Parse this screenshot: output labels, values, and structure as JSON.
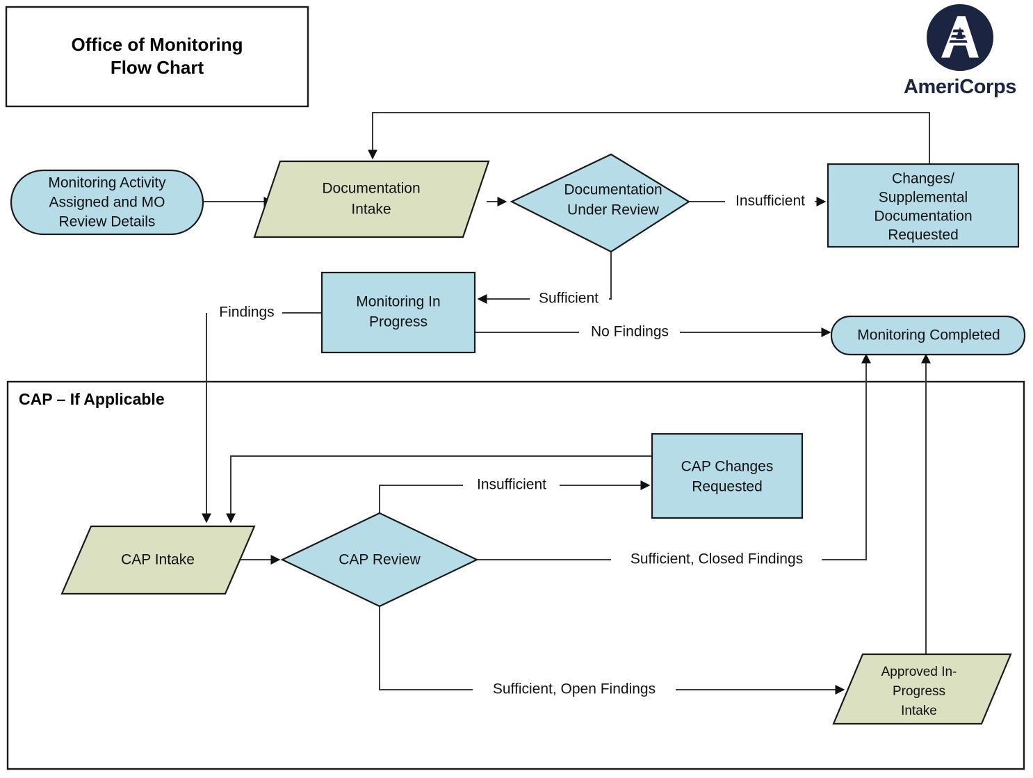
{
  "title": {
    "line1": "Office of Monitoring",
    "line2": "Flow Chart"
  },
  "logo": {
    "name": "americorps-logo",
    "wordmark": "AmeriCorps",
    "color": "#1b2440"
  },
  "colors": {
    "process_blue": "#b5dce7",
    "data_green": "#dae0c0",
    "line": "#3a3a3a",
    "border": "#1a1a1a"
  },
  "nodes": {
    "start": {
      "label": "Monitoring Activity Assigned and MO Review Details",
      "lines": [
        "Monitoring Activity",
        "Assigned and MO",
        "Review Details"
      ],
      "shape": "rounded",
      "fill": "#b5dce7"
    },
    "doc_intake": {
      "label": "Documentation Intake",
      "lines": [
        "Documentation",
        "Intake"
      ],
      "shape": "parallelogram",
      "fill": "#dae0c0"
    },
    "doc_review": {
      "label": "Documentation Under Review",
      "lines": [
        "Documentation",
        "Under Review"
      ],
      "shape": "diamond",
      "fill": "#b5dce7"
    },
    "changes_requested": {
      "label": "Changes/ Supplemental Documentation Requested",
      "lines": [
        "Changes/",
        "Supplemental",
        "Documentation",
        "Requested"
      ],
      "shape": "rectangle",
      "fill": "#b5dce7"
    },
    "monitoring_in_progress": {
      "label": "Monitoring In Progress",
      "lines": [
        "Monitoring In",
        "Progress"
      ],
      "shape": "rectangle",
      "fill": "#b5dce7"
    },
    "monitoring_completed": {
      "label": "Monitoring Completed",
      "lines": [
        "Monitoring Completed"
      ],
      "shape": "rounded",
      "fill": "#b5dce7"
    },
    "cap_intake": {
      "label": "CAP Intake",
      "lines": [
        "CAP Intake"
      ],
      "shape": "parallelogram",
      "fill": "#dae0c0"
    },
    "cap_review": {
      "label": "CAP Review",
      "lines": [
        "CAP Review"
      ],
      "shape": "diamond",
      "fill": "#b5dce7"
    },
    "cap_changes_requested": {
      "label": "CAP Changes Requested",
      "lines": [
        "CAP Changes",
        "Requested"
      ],
      "shape": "rectangle",
      "fill": "#b5dce7"
    },
    "approved_in_progress_intake": {
      "label": "Approved In-Progress Intake",
      "lines": [
        "Approved In-",
        "Progress",
        "Intake"
      ],
      "shape": "parallelogram",
      "fill": "#dae0c0"
    }
  },
  "groups": {
    "cap_group": {
      "label": "CAP – If Applicable"
    }
  },
  "edge_labels": {
    "insufficient_doc": "Insufficient",
    "sufficient_doc": "Sufficient",
    "findings": "Findings",
    "no_findings": "No Findings",
    "insufficient_cap": "Insufficient",
    "sufficient_closed": "Sufficient, Closed Findings",
    "sufficient_open": "Sufficient, Open Findings"
  },
  "chart_data": {
    "type": "flowchart",
    "title": "Office of Monitoring Flow Chart",
    "nodes": [
      {
        "id": "start",
        "label": "Monitoring Activity Assigned and MO Review Details",
        "shape": "rounded-rectangle",
        "fill": "#b5dce7"
      },
      {
        "id": "doc_intake",
        "label": "Documentation Intake",
        "shape": "parallelogram",
        "fill": "#dae0c0"
      },
      {
        "id": "doc_review",
        "label": "Documentation Under Review",
        "shape": "diamond",
        "fill": "#b5dce7"
      },
      {
        "id": "changes_requested",
        "label": "Changes/ Supplemental Documentation Requested",
        "shape": "rectangle",
        "fill": "#b5dce7"
      },
      {
        "id": "monitoring_in_progress",
        "label": "Monitoring In Progress",
        "shape": "rectangle",
        "fill": "#b5dce7"
      },
      {
        "id": "monitoring_completed",
        "label": "Monitoring Completed",
        "shape": "rounded-rectangle",
        "fill": "#b5dce7"
      },
      {
        "id": "cap_intake",
        "label": "CAP Intake",
        "shape": "parallelogram",
        "fill": "#dae0c0"
      },
      {
        "id": "cap_review",
        "label": "CAP Review",
        "shape": "diamond",
        "fill": "#b5dce7"
      },
      {
        "id": "cap_changes_requested",
        "label": "CAP Changes Requested",
        "shape": "rectangle",
        "fill": "#b5dce7"
      },
      {
        "id": "approved_in_progress_intake",
        "label": "Approved In-Progress Intake",
        "shape": "parallelogram",
        "fill": "#dae0c0"
      }
    ],
    "edges": [
      {
        "from": "start",
        "to": "doc_intake",
        "label": ""
      },
      {
        "from": "doc_intake",
        "to": "doc_review",
        "label": ""
      },
      {
        "from": "doc_review",
        "to": "changes_requested",
        "label": "Insufficient"
      },
      {
        "from": "changes_requested",
        "to": "doc_intake",
        "label": ""
      },
      {
        "from": "doc_review",
        "to": "monitoring_in_progress",
        "label": "Sufficient"
      },
      {
        "from": "monitoring_in_progress",
        "to": "cap_intake",
        "label": "Findings"
      },
      {
        "from": "monitoring_in_progress",
        "to": "monitoring_completed",
        "label": "No Findings"
      },
      {
        "from": "cap_intake",
        "to": "cap_review",
        "label": ""
      },
      {
        "from": "cap_review",
        "to": "cap_changes_requested",
        "label": "Insufficient"
      },
      {
        "from": "cap_changes_requested",
        "to": "cap_intake",
        "label": ""
      },
      {
        "from": "cap_review",
        "to": "monitoring_completed",
        "label": "Sufficient, Closed Findings"
      },
      {
        "from": "cap_review",
        "to": "approved_in_progress_intake",
        "label": "Sufficient, Open Findings"
      },
      {
        "from": "approved_in_progress_intake",
        "to": "monitoring_completed",
        "label": ""
      }
    ],
    "groups": [
      {
        "id": "cap_group",
        "label": "CAP – If Applicable",
        "members": [
          "cap_intake",
          "cap_review",
          "cap_changes_requested",
          "approved_in_progress_intake"
        ]
      }
    ]
  }
}
